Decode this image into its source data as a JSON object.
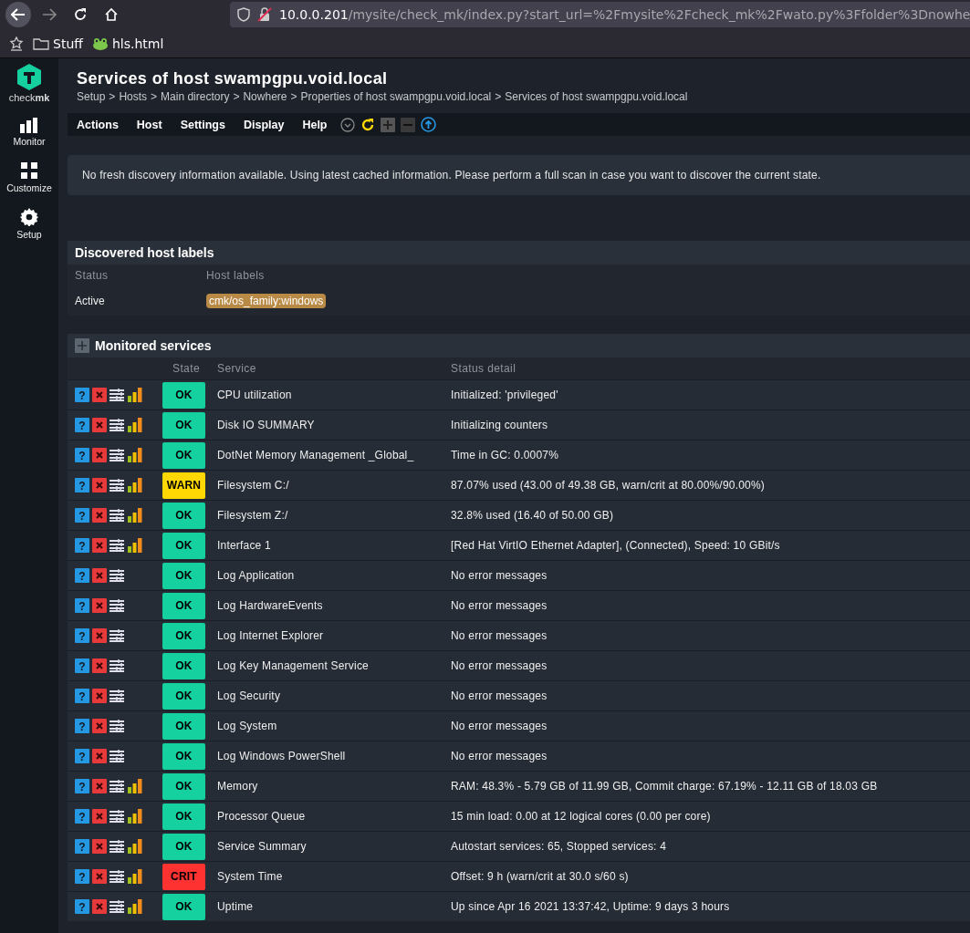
{
  "browser": {
    "url_host": "10.0.0.201",
    "url_path": "/mysite/check_mk/index.py?start_url=%2Fmysite%2Fcheck_mk%2Fwato.py%3Ffolder%3Dnowhe",
    "bookmarks": [
      {
        "kind": "folder",
        "label": "Stuff"
      },
      {
        "kind": "frog",
        "label": "hls.html"
      }
    ]
  },
  "sidebar": {
    "logo_text": "check",
    "logo_bold": "mk",
    "items": [
      {
        "kind": "monitor",
        "label": "Monitor"
      },
      {
        "kind": "customize",
        "label": "Customize"
      },
      {
        "kind": "setup",
        "label": "Setup"
      }
    ]
  },
  "page": {
    "title": "Services of host swampgpu.void.local",
    "breadcrumb_separator": ">",
    "breadcrumb": [
      "Setup",
      "Hosts",
      "Main directory",
      "Nowhere",
      "Properties of host swampgpu.void.local",
      "Services of host swampgpu.void.local"
    ],
    "menu": [
      "Actions",
      "Host",
      "Settings",
      "Display",
      "Help"
    ],
    "message": "No fresh discovery information available. Using latest cached information. Please perform a full scan in case you want to discover the current state."
  },
  "host_labels": {
    "title": "Discovered host labels",
    "columns": [
      "Status",
      "Host labels"
    ],
    "rows": [
      {
        "status": "Active",
        "label": "cmk/os_family:windows"
      }
    ]
  },
  "services": {
    "title": "Monitored services",
    "help_symbol": "?",
    "columns": [
      "State",
      "Service",
      "Status detail"
    ],
    "rows": [
      {
        "state": "OK",
        "kind": "ok",
        "service": "CPU utilization",
        "detail": "Initialized: 'privileged'",
        "graph": true
      },
      {
        "state": "OK",
        "kind": "ok",
        "service": "Disk IO SUMMARY",
        "detail": "Initializing counters",
        "graph": true
      },
      {
        "state": "OK",
        "kind": "ok",
        "service": "DotNet Memory Management _Global_",
        "detail": "Time in GC: 0.0007%",
        "graph": true
      },
      {
        "state": "WARN",
        "kind": "warn",
        "service": "Filesystem C:/",
        "detail": "87.07% used (43.00 of 49.38 GB, warn/crit at 80.00%/90.00%)",
        "graph": true
      },
      {
        "state": "OK",
        "kind": "ok",
        "service": "Filesystem Z:/",
        "detail": "32.8% used (16.40 of 50.00 GB)",
        "graph": true
      },
      {
        "state": "OK",
        "kind": "ok",
        "service": "Interface 1",
        "detail": "[Red Hat VirtIO Ethernet Adapter], (Connected), Speed: 10 GBit/s",
        "graph": true
      },
      {
        "state": "OK",
        "kind": "ok",
        "service": "Log Application",
        "detail": "No error messages",
        "graph": false
      },
      {
        "state": "OK",
        "kind": "ok",
        "service": "Log HardwareEvents",
        "detail": "No error messages",
        "graph": false
      },
      {
        "state": "OK",
        "kind": "ok",
        "service": "Log Internet Explorer",
        "detail": "No error messages",
        "graph": false
      },
      {
        "state": "OK",
        "kind": "ok",
        "service": "Log Key Management Service",
        "detail": "No error messages",
        "graph": false
      },
      {
        "state": "OK",
        "kind": "ok",
        "service": "Log Security",
        "detail": "No error messages",
        "graph": false
      },
      {
        "state": "OK",
        "kind": "ok",
        "service": "Log System",
        "detail": "No error messages",
        "graph": false
      },
      {
        "state": "OK",
        "kind": "ok",
        "service": "Log Windows PowerShell",
        "detail": "No error messages",
        "graph": false
      },
      {
        "state": "OK",
        "kind": "ok",
        "service": "Memory",
        "detail": "RAM: 48.3% - 5.79 GB of 11.99 GB, Commit charge: 67.19% - 12.11 GB of 18.03 GB",
        "graph": true
      },
      {
        "state": "OK",
        "kind": "ok",
        "service": "Processor Queue",
        "detail": "15 min load: 0.00 at 12 logical cores (0.00 per core)",
        "graph": true
      },
      {
        "state": "OK",
        "kind": "ok",
        "service": "Service Summary",
        "detail": "Autostart services: 65, Stopped services: 4",
        "graph": true
      },
      {
        "state": "CRIT",
        "kind": "crit",
        "service": "System Time",
        "detail": "Offset: 9 h (warn/crit at 30.0 s/60 s)",
        "graph": true
      },
      {
        "state": "OK",
        "kind": "ok",
        "service": "Uptime",
        "detail": "Up since Apr 16 2021 13:37:42, Uptime: 9 days 3 hours",
        "graph": true
      }
    ]
  }
}
